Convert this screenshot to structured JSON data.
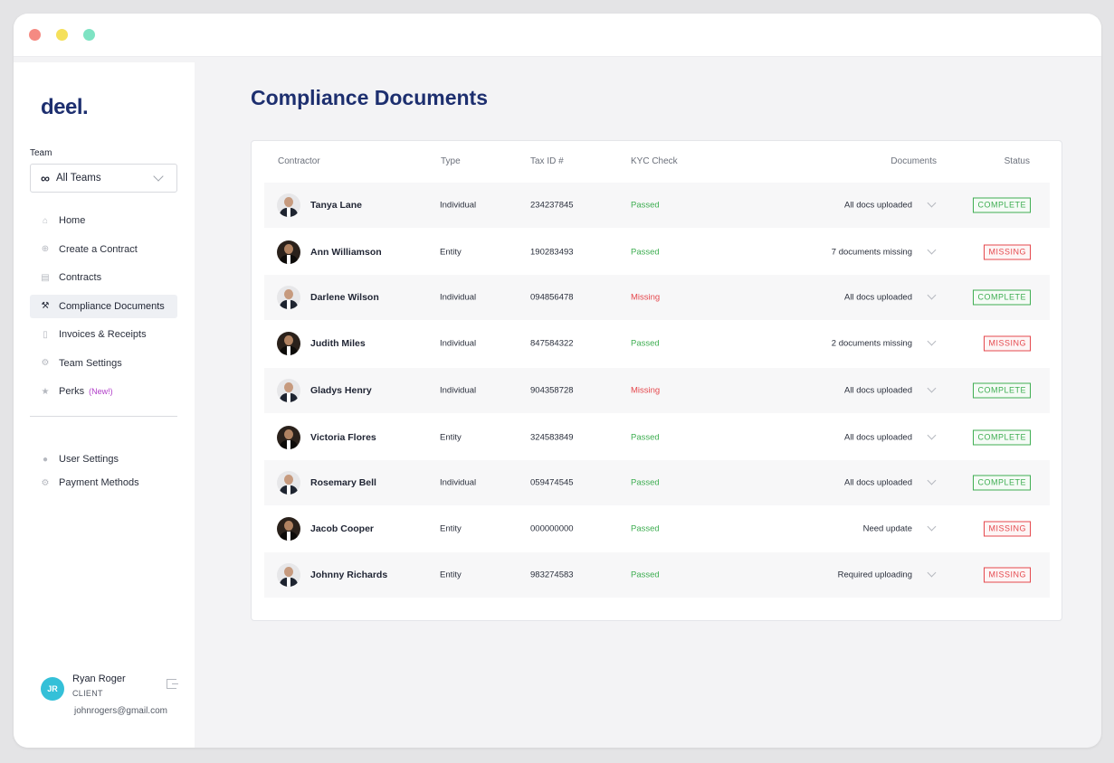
{
  "sidebar": {
    "logo": "deel.",
    "team_label": "Team",
    "team_select": "All Teams",
    "nav": [
      {
        "label": "Home",
        "icon": "home-icon"
      },
      {
        "label": "Create a Contract",
        "icon": "plus-circle-icon"
      },
      {
        "label": "Contracts",
        "icon": "document-icon"
      },
      {
        "label": "Compliance Documents",
        "icon": "hammer-icon",
        "active": true
      },
      {
        "label": "Invoices & Receipts",
        "icon": "receipt-icon"
      },
      {
        "label": "Team Settings",
        "icon": "gear-icon"
      },
      {
        "label": "Perks",
        "icon": "star-icon",
        "badge": "(New!)"
      }
    ],
    "nav2": [
      {
        "label": "User Settings",
        "icon": "user-icon"
      },
      {
        "label": "Payment Methods",
        "icon": "gear-icon"
      }
    ],
    "profile": {
      "initials": "JR",
      "name": "Ryan Roger",
      "role": "CLIENT",
      "email": "johnrogers@gmail.com"
    }
  },
  "main": {
    "title": "Compliance Documents",
    "columns": [
      "Contractor",
      "Type",
      "Tax ID #",
      "KYC Check",
      "Documents",
      "Status"
    ],
    "rows": [
      {
        "name": "Tanya Lane",
        "type": "Individual",
        "tax_id": "234237845",
        "kyc": "Passed",
        "documents": "All docs uploaded",
        "status": "COMPLETE",
        "avatar": "light"
      },
      {
        "name": "Ann Williamson",
        "type": "Entity",
        "tax_id": "190283493",
        "kyc": "Passed",
        "documents": "7 documents missing",
        "status": "MISSING",
        "avatar": "dark"
      },
      {
        "name": "Darlene Wilson",
        "type": "Individual",
        "tax_id": "094856478",
        "kyc": "Missing",
        "documents": "All docs uploaded",
        "status": "COMPLETE",
        "avatar": "light"
      },
      {
        "name": "Judith Miles",
        "type": "Individual",
        "tax_id": "847584322",
        "kyc": "Passed",
        "documents": "2 documents missing",
        "status": "MISSING",
        "avatar": "dark"
      },
      {
        "name": "Gladys Henry",
        "type": "Individual",
        "tax_id": "904358728",
        "kyc": "Missing",
        "documents": "All docs uploaded",
        "status": "COMPLETE",
        "avatar": "light"
      },
      {
        "name": "Victoria Flores",
        "type": "Entity",
        "tax_id": "324583849",
        "kyc": "Passed",
        "documents": "All docs uploaded",
        "status": "COMPLETE",
        "avatar": "dark"
      },
      {
        "name": "Rosemary Bell",
        "type": "Individual",
        "tax_id": "059474545",
        "kyc": "Passed",
        "documents": "All docs uploaded",
        "status": "COMPLETE",
        "avatar": "light"
      },
      {
        "name": "Jacob Cooper",
        "type": "Entity",
        "tax_id": "000000000",
        "kyc": "Passed",
        "documents": "Need update",
        "status": "MISSING",
        "avatar": "dark"
      },
      {
        "name": "Johnny Richards",
        "type": "Entity",
        "tax_id": "983274583",
        "kyc": "Passed",
        "documents": "Required uploading",
        "status": "MISSING",
        "avatar": "light"
      }
    ]
  },
  "colors": {
    "brand": "#1d2f6f",
    "passed": "#3fae52",
    "missing": "#e5484d",
    "new_badge": "#b03cc8"
  }
}
